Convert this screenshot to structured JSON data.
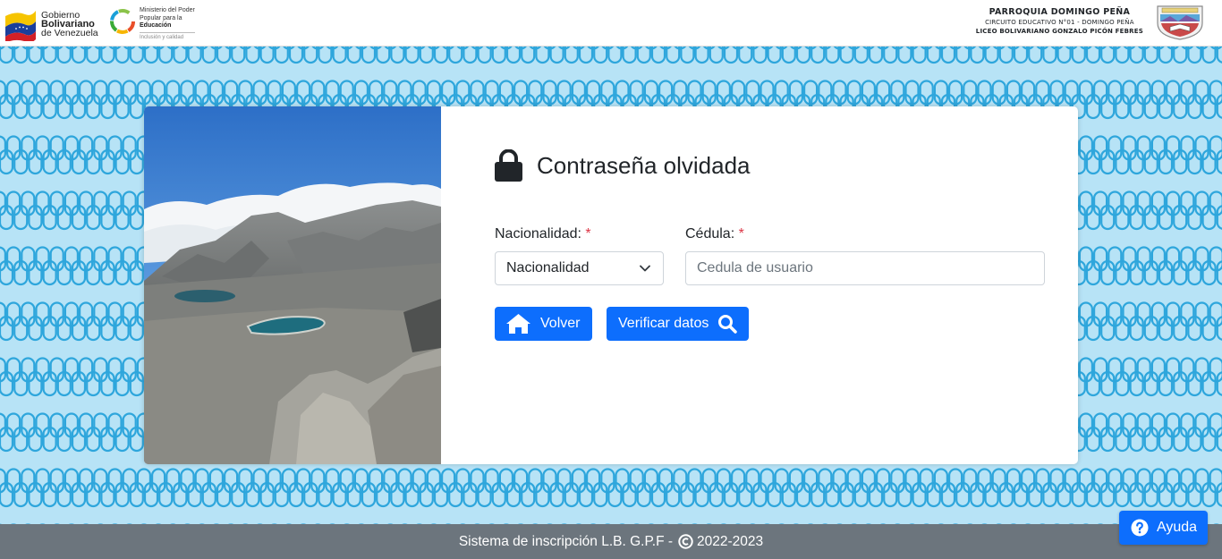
{
  "header": {
    "gov_line1": "Gobierno",
    "gov_line2": "Bolivariano",
    "gov_line3": "de Venezuela",
    "ministry_line1": "Ministerio del Poder",
    "ministry_line2": "Popular para la",
    "ministry_line3": "Educación",
    "ministry_tagline": "Inclusión y calidad",
    "school_line1": "PARROQUIA DOMINGO PEÑA",
    "school_line2": "CIRCUITO EDUCATIVO N°01 - DOMINGO PEÑA",
    "school_line3": "LICEO BOLIVARIANO GONZALO PICÓN FEBRES"
  },
  "form": {
    "title": "Contraseña olvidada",
    "nacionalidad_label": "Nacionalidad:",
    "cedula_label": "Cédula:",
    "required_mark": "*",
    "nacionalidad_selected": "Nacionalidad",
    "cedula_placeholder": "Cedula de usuario",
    "cedula_value": "",
    "volver_label": "Volver",
    "verificar_label": "Verificar datos"
  },
  "footer": {
    "text_before": "Sistema de inscripción L.B. G.P.F -",
    "text_after": "2022-2023"
  },
  "help": {
    "label": "Ayuda"
  },
  "icons": {
    "lock": "lock-icon",
    "home": "home-icon",
    "search": "search-icon",
    "chevron": "chevron-down-icon",
    "copyright": "copyright-icon",
    "question": "question-circle-icon"
  },
  "colors": {
    "primary": "#0d6efd",
    "footer_bg": "#6c757d",
    "pattern_bg": "#b7e3f6",
    "pattern_stroke": "#2ea6dc",
    "required": "#dc3545"
  }
}
